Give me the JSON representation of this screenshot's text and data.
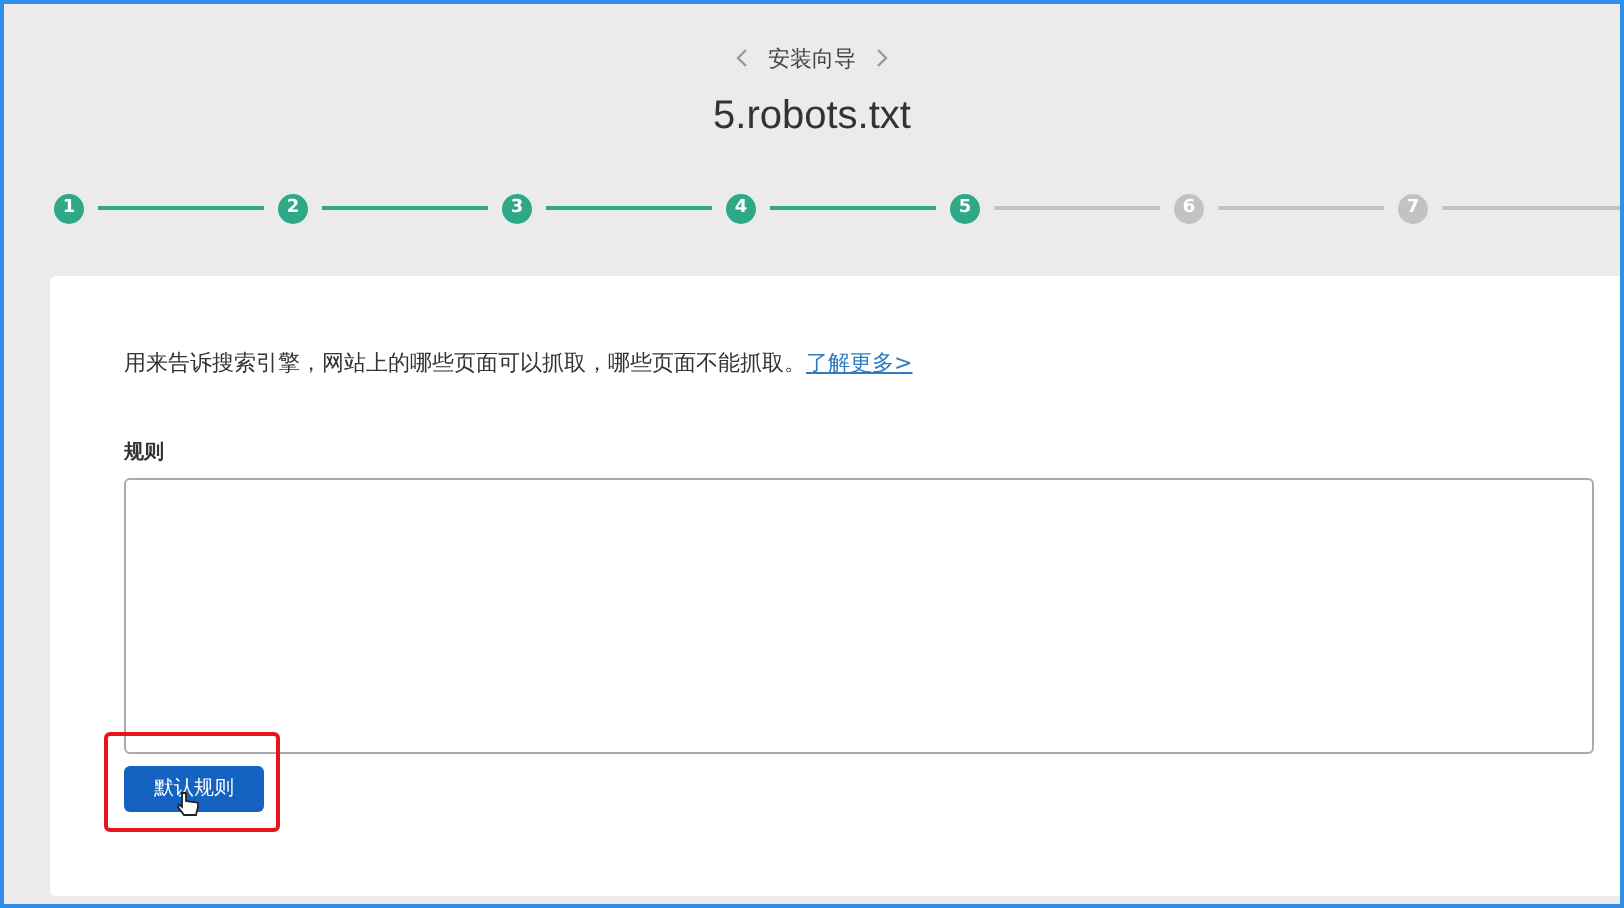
{
  "header": {
    "nav_title": "安装向导",
    "page_title": "5.robots.txt"
  },
  "steps": [
    {
      "number": "1",
      "done": true
    },
    {
      "number": "2",
      "done": true
    },
    {
      "number": "3",
      "done": true
    },
    {
      "number": "4",
      "done": true
    },
    {
      "number": "5",
      "done": true
    },
    {
      "number": "6",
      "done": false
    },
    {
      "number": "7",
      "done": false
    }
  ],
  "card": {
    "description": "用来告诉搜索引擎，网站上的哪些页面可以抓取，哪些页面不能抓取。",
    "link": "了解更多>",
    "field_label": "规则",
    "button": {
      "label": "默认规则",
      "highlighted": true
    }
  }
}
